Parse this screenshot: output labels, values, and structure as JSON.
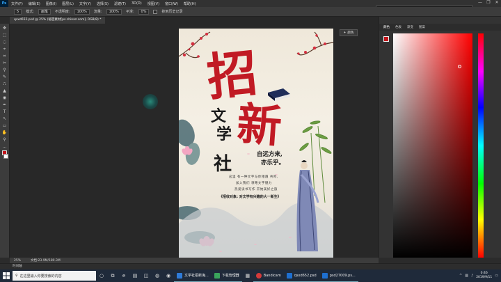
{
  "menubar": {
    "logo": "Ps",
    "items": [
      "文件(F)",
      "编辑(E)",
      "图像(I)",
      "图层(L)",
      "文字(Y)",
      "选择(S)",
      "滤镜(T)",
      "3D(D)",
      "视图(V)",
      "窗口(W)",
      "帮助(H)"
    ]
  },
  "recorder": {
    "status": "正在录制 [00:01:48]"
  },
  "window_controls": [
    "—",
    "❐",
    "✕"
  ],
  "options": {
    "size": "5",
    "mode_label": "模式:",
    "mode_value": "画笔",
    "opacity_label": "不透明度:",
    "opacity_value": "100%",
    "flow_label": "流量:",
    "flow_value": "100%",
    "smooth_label": "平滑:",
    "smooth_value": "0%",
    "erase_history": "抹到历史记录"
  },
  "document": {
    "tab_title": "qsxd652.psd @ 25% (秘密素材[ps.chinaz.com], RGB/8) *"
  },
  "tools": [
    "✥",
    "⬚",
    "◌",
    "⌖",
    "⌗",
    "✂",
    "⚲",
    "✎",
    "⎍",
    "▲",
    "◉",
    "✒",
    "T",
    "↖",
    "▭",
    "✋",
    "⚲",
    "…"
  ],
  "poster": {
    "title_zhao": "招",
    "title_xin": "新",
    "club_wen": "文",
    "club_xue": "学",
    "club_she": "社",
    "tagline_1": "自远方来,",
    "tagline_2": "亦乐乎。",
    "poem": [
      "这里 有一种文字与你相遇 共鸣,",
      "加入我们 领略文字魅力",
      "热爱读书写作 开始美好之旅"
    ],
    "recruit_target": "《招收对象: 对文学有兴趣的大一新生》"
  },
  "tooltip": {
    "label": "颜色"
  },
  "right_panel": {
    "tabs": [
      "颜色",
      "色板",
      "渐变",
      "图案"
    ],
    "active_tab": "颜色"
  },
  "statusbar": {
    "zoom": "25%",
    "doc_info": "文档:23.9M/180.3M"
  },
  "timeline": {
    "label": "时间轴"
  },
  "taskbar": {
    "search_placeholder": "在这里输入你要搜索的内容",
    "apps": [
      {
        "label": "文学社招新海...",
        "color": "#2f7bd8"
      },
      {
        "label": "下载管理器",
        "color": "#3aa55c"
      },
      {
        "label": "Bandicam",
        "color": "#d23a3a"
      },
      {
        "label": "qsxd652.psd",
        "color": "#1e6fd0"
      },
      {
        "label": "psd27009.ps...",
        "color": "#1e6fd0"
      }
    ],
    "clock_time": "0:46",
    "clock_date": "2019/9/11"
  },
  "colors": {
    "foreground": "#c4151c",
    "background": "#ffffff",
    "accent": "#31a8ff"
  }
}
